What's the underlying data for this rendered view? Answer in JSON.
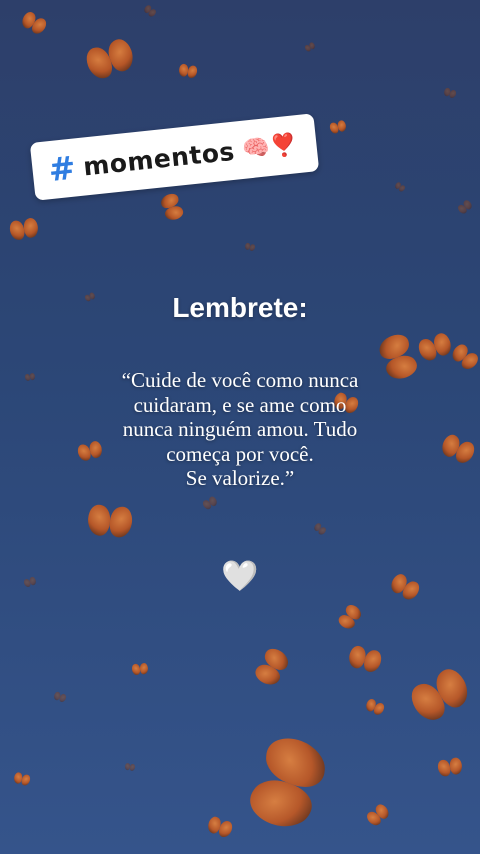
{
  "sticker": {
    "hash": "#",
    "text": "momentos",
    "emoji": "🧠❣️"
  },
  "title": "Lembrete:",
  "quote_lines": [
    "“Cuide de você como nunca",
    "cuidaram, e se ame como",
    "nunca ninguém amou. Tudo",
    "começa por você.",
    "Se valorize.”"
  ],
  "heart": "🤍",
  "colors": {
    "background": "#2c4777",
    "butterfly": "#d0642a",
    "hashtag": "#2f7de1"
  },
  "icons": [
    "brain-icon",
    "heart-exclamation-icon",
    "white-heart-icon",
    "butterfly-icon"
  ]
}
